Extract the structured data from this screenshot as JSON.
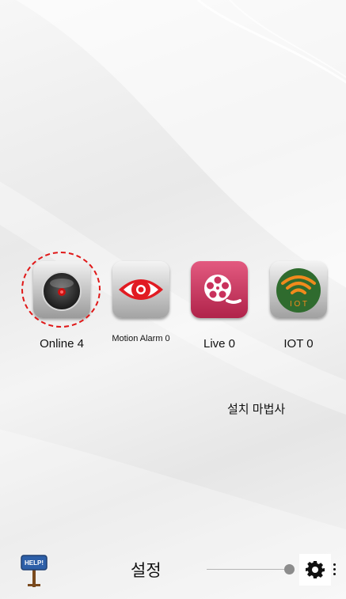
{
  "apps": [
    {
      "label": "Online 4",
      "icon": "camera-lens-icon"
    },
    {
      "label": "Motion Alarm 0",
      "icon": "eye-icon"
    },
    {
      "label": "Live 0",
      "icon": "film-reel-icon"
    },
    {
      "label": "IOT 0",
      "icon": "wifi-iot-icon"
    }
  ],
  "iot_badge_text": "I O T",
  "wizard_label": "설치 마법사",
  "footer": {
    "help_sign_text": "HELP!",
    "settings_label": "설정",
    "gear_icon": "gear-icon",
    "more_icon": "more-vertical-icon"
  },
  "colors": {
    "selection_ring": "#e01818",
    "motion_eye": "#e11b22",
    "live_tile": "#c9315c",
    "iot_tile": "#2f6b2e",
    "iot_waves": "#f08a1c"
  }
}
